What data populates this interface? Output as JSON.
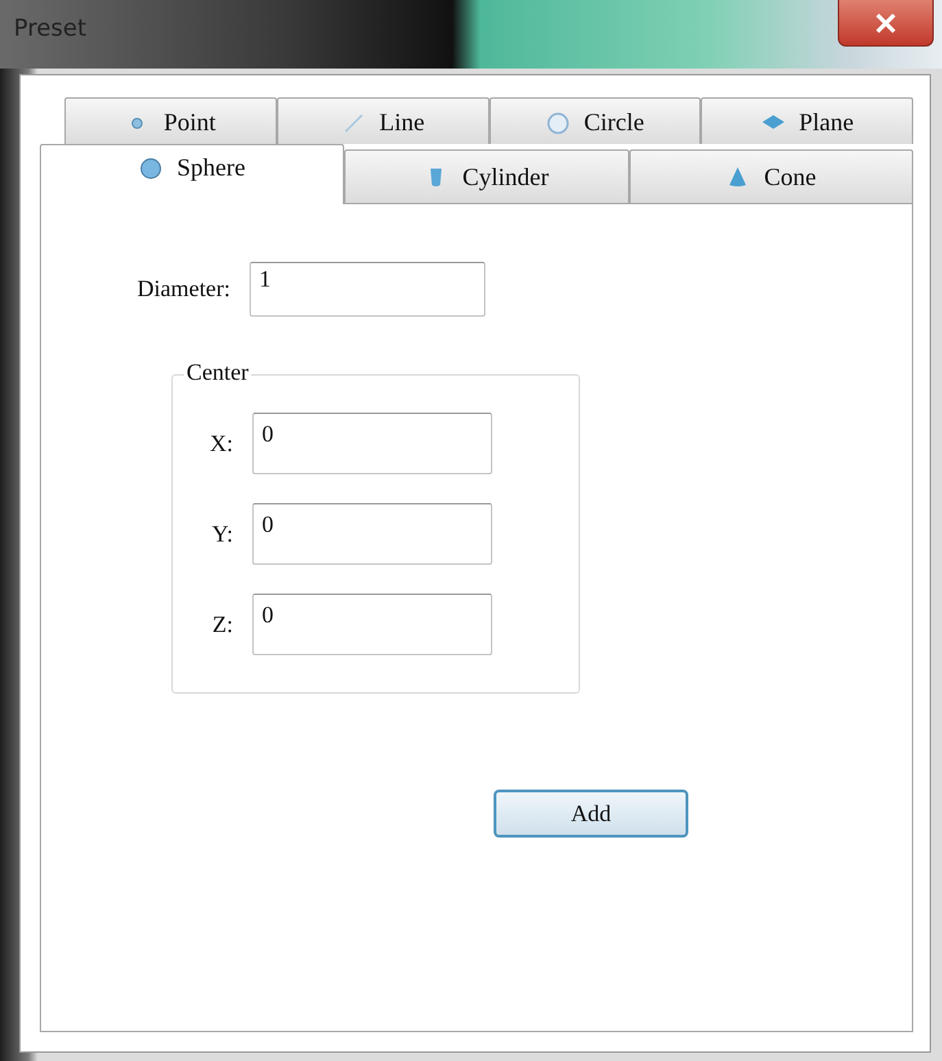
{
  "window": {
    "title": "Preset"
  },
  "tab_rows": [
    {
      "tabs": [
        {
          "label": "Point",
          "kind": "point",
          "selected": false
        },
        {
          "label": "Line",
          "kind": "line",
          "selected": false
        },
        {
          "label": "Circle",
          "kind": "circle",
          "selected": false
        },
        {
          "label": "Plane",
          "kind": "plane",
          "selected": false
        }
      ]
    },
    {
      "tabs": [
        {
          "label": "Sphere",
          "kind": "sphere",
          "selected": true
        },
        {
          "label": "Cylinder",
          "kind": "cylinder",
          "selected": false
        },
        {
          "label": "Cone",
          "kind": "cone",
          "selected": false
        }
      ]
    }
  ],
  "diameter": {
    "label": "Diameter:",
    "value": "1"
  },
  "center": {
    "title": "Center",
    "fields": [
      {
        "label": "X:",
        "value": "0"
      },
      {
        "label": "Y:",
        "value": "0"
      },
      {
        "label": "Z:",
        "value": "0"
      }
    ]
  },
  "add_button": "Add"
}
